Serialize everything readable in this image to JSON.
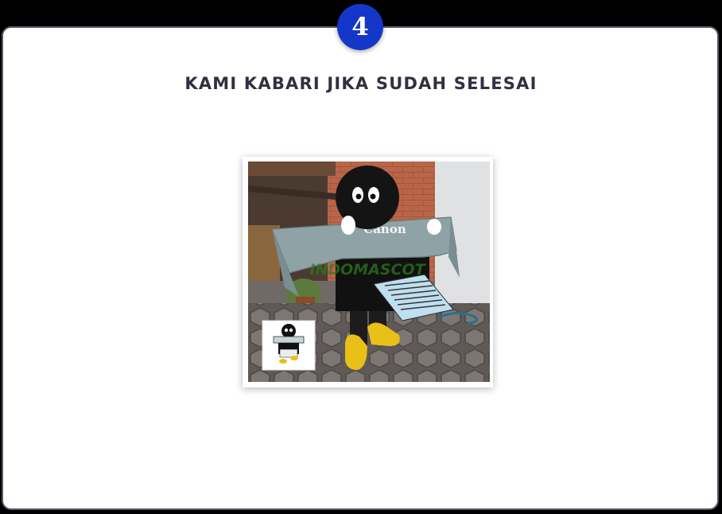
{
  "step": {
    "number": "4"
  },
  "section": {
    "title": "KAMI KABARI JIKA SUDAH SELESAI"
  },
  "photo": {
    "brand_label": "Canon",
    "watermark": "INDOMASCOT"
  },
  "colors": {
    "badge": "#1537c9",
    "title": "#2f3142",
    "card_border": "#555866"
  }
}
